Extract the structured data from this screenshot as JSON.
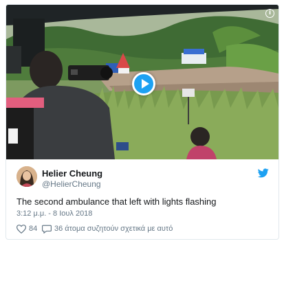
{
  "tweet": {
    "author": {
      "display_name": "Helier Cheung",
      "username": "@HelierCheung"
    },
    "text": "The second ambulance that left with lights flashing",
    "timestamp": "3:12 μ.μ. - 8 Ιουλ 2018",
    "likes_count": "84",
    "conversation_label": "36 άτομα συζητούν σχετικά με αυτό"
  },
  "media": {
    "type": "video",
    "play_icon": "play-icon",
    "info_icon": "info-icon",
    "info_glyph": "i"
  },
  "icons": {
    "brand": "twitter-bird-icon",
    "like": "heart-icon",
    "reply": "speech-bubble-icon"
  },
  "colors": {
    "twitter_blue": "#1da1f2",
    "secondary_text": "#657786",
    "border": "#e1e8ed"
  }
}
